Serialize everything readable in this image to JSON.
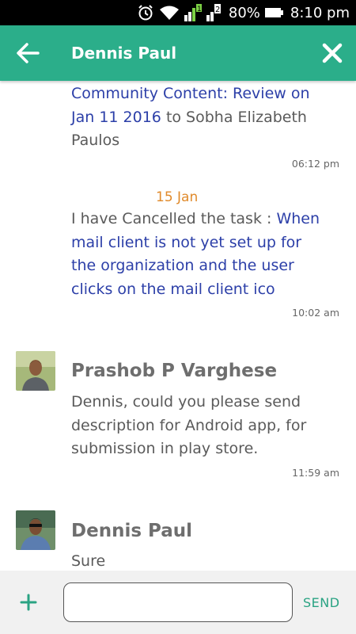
{
  "status_bar": {
    "battery": "80%",
    "time": "8:10 pm",
    "sim1": "1",
    "sim2": "2"
  },
  "app_bar": {
    "title": "Dennis Paul",
    "color": "#2bae8a"
  },
  "messages": [
    {
      "link_text": "Community Content: Review on Jan 11 2016",
      "text": " to Sobha Elizabeth Paulos",
      "time": "06:12 pm"
    },
    {
      "date": "15 Jan",
      "text": "I have Cancelled the task : ",
      "link_text": "When mail client is not yet set up for the organization and the user clicks on the mail client ico",
      "time": "10:02 am"
    },
    {
      "sender": "Prashob P Varghese",
      "text": "Dennis, could you please send description for Android app, for submission in play store.",
      "time": "11:59 am"
    },
    {
      "sender": "Dennis Paul",
      "text": "Sure"
    }
  ],
  "composer": {
    "input_value": "",
    "send_label": "SEND"
  },
  "colors": {
    "accent": "#2bae8a",
    "link": "#2c3fa8",
    "date": "#e08a2b"
  }
}
